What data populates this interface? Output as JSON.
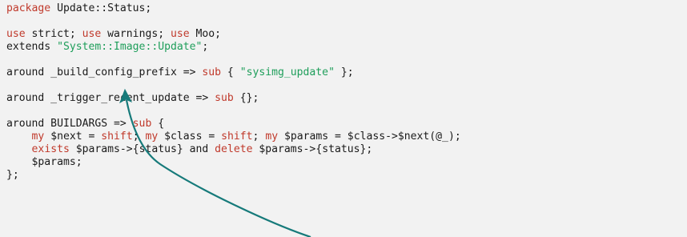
{
  "colors": {
    "background": "#f2f2f2",
    "text": "#1a1a1a",
    "keyword": "#c0392b",
    "string": "#1e9e5a",
    "arrow": "#167a7a"
  },
  "code_lines": [
    [
      {
        "t": "kw",
        "v": "package"
      },
      {
        "t": "plain",
        "v": " Update::Status;"
      }
    ],
    [],
    [
      {
        "t": "kw",
        "v": "use"
      },
      {
        "t": "plain",
        "v": " strict; "
      },
      {
        "t": "kw",
        "v": "use"
      },
      {
        "t": "plain",
        "v": " warnings; "
      },
      {
        "t": "kw",
        "v": "use"
      },
      {
        "t": "plain",
        "v": " Moo;"
      }
    ],
    [
      {
        "t": "plain",
        "v": "extends "
      },
      {
        "t": "str",
        "v": "\"System::Image::Update\""
      },
      {
        "t": "plain",
        "v": ";"
      }
    ],
    [],
    [
      {
        "t": "plain",
        "v": "around _build_config_prefix => "
      },
      {
        "t": "kw",
        "v": "sub"
      },
      {
        "t": "plain",
        "v": " { "
      },
      {
        "t": "str",
        "v": "\"sysimg_update\""
      },
      {
        "t": "plain",
        "v": " };"
      }
    ],
    [],
    [
      {
        "t": "plain",
        "v": "around _trigger_recent_update => "
      },
      {
        "t": "kw",
        "v": "sub"
      },
      {
        "t": "plain",
        "v": " {};"
      }
    ],
    [],
    [
      {
        "t": "plain",
        "v": "around BUILDARGS => "
      },
      {
        "t": "kw",
        "v": "sub"
      },
      {
        "t": "plain",
        "v": " {"
      }
    ],
    [
      {
        "t": "plain",
        "v": "    "
      },
      {
        "t": "kw",
        "v": "my"
      },
      {
        "t": "plain",
        "v": " $next = "
      },
      {
        "t": "kw",
        "v": "shift"
      },
      {
        "t": "plain",
        "v": "; "
      },
      {
        "t": "kw",
        "v": "my"
      },
      {
        "t": "plain",
        "v": " $class = "
      },
      {
        "t": "kw",
        "v": "shift"
      },
      {
        "t": "plain",
        "v": "; "
      },
      {
        "t": "kw",
        "v": "my"
      },
      {
        "t": "plain",
        "v": " $params = $class->$next(@_);"
      }
    ],
    [
      {
        "t": "plain",
        "v": "    "
      },
      {
        "t": "kw",
        "v": "exists"
      },
      {
        "t": "plain",
        "v": " $params->{status} and "
      },
      {
        "t": "kw",
        "v": "delete"
      },
      {
        "t": "plain",
        "v": " $params->{status};"
      }
    ],
    [
      {
        "t": "plain",
        "v": "    $params;"
      }
    ],
    [
      {
        "t": "plain",
        "v": "};"
      }
    ]
  ]
}
